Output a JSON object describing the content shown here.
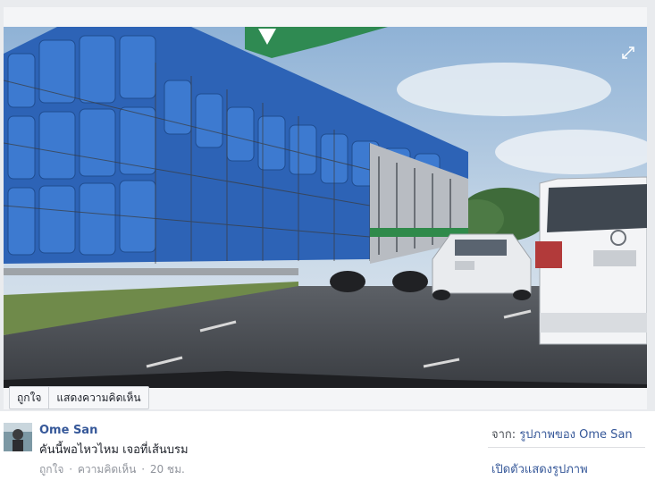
{
  "photo": {
    "alt": "",
    "expand_icon": "expand-icon"
  },
  "actions": {
    "like_label": "ถูกใจ",
    "comment_label": "แสดงความคิดเห็น"
  },
  "post": {
    "author": "Ome San",
    "caption": "คันนี้พอไหวไหม เจอที่เส้นบรม",
    "meta_like": "ถูกใจ",
    "meta_sep": "·",
    "meta_comment": "ความคิดเห็น",
    "meta_time": "20 ชม."
  },
  "sidebar": {
    "from_prefix": "จาก:",
    "from_link": "รูปภาพของ Ome San",
    "open_viewer": "เปิดตัวแสดงรูปภาพ"
  },
  "colors": {
    "link": "#365899",
    "muted": "#90949c",
    "background": "#e9ebee"
  }
}
